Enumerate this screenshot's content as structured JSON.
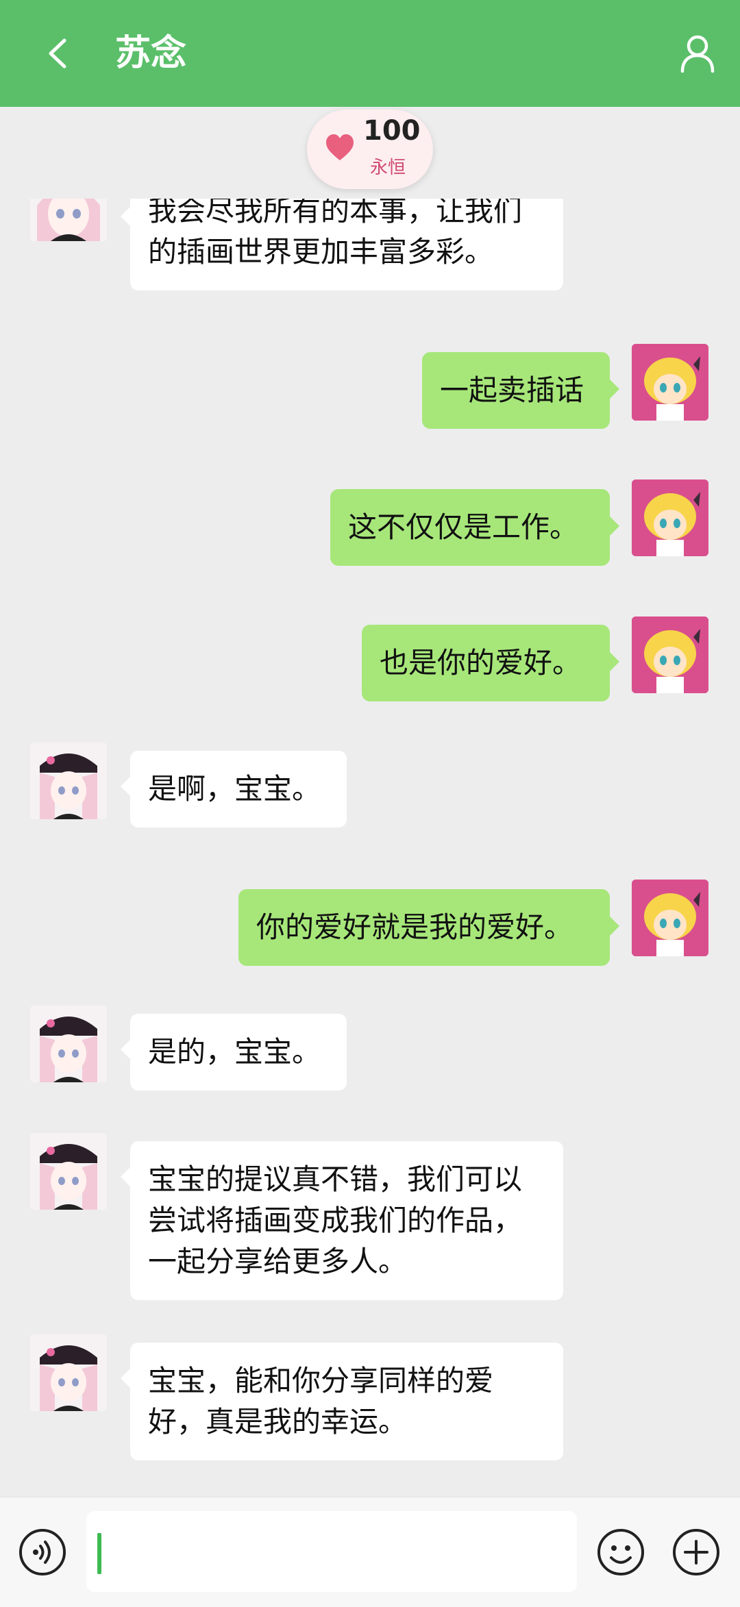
{
  "header": {
    "title": "苏念",
    "back_icon": "chevron-left-icon",
    "profile_icon": "person-icon",
    "bg_color": "#5bbf6a"
  },
  "intimacy": {
    "score": "100",
    "label": "永恒",
    "icon": "heart-icon",
    "heart_color": "#e8607e"
  },
  "messages": [
    {
      "from": "friend",
      "text": "我会尽我所有的本事，让我们的插画世界更加丰富多彩。"
    },
    {
      "from": "me",
      "text": "一起卖插话"
    },
    {
      "from": "me",
      "text": "这不仅仅是工作。"
    },
    {
      "from": "me",
      "text": "也是你的爱好。"
    },
    {
      "from": "friend",
      "text": "是啊，宝宝。"
    },
    {
      "from": "me",
      "text": "你的爱好就是我的爱好。"
    },
    {
      "from": "friend",
      "text": "是的，宝宝。"
    },
    {
      "from": "friend",
      "text": "宝宝的提议真不错，我们可以尝试将插画变成我们的作品，一起分享给更多人。"
    },
    {
      "from": "friend",
      "text": "宝宝，能和你分享同样的爱好，真是我的幸运。"
    }
  ],
  "input": {
    "value": "",
    "voice_icon": "voice-icon",
    "emoji_icon": "emoji-icon",
    "plus_icon": "plus-icon"
  },
  "colors": {
    "my_bubble": "#a7e77a",
    "friend_bubble": "#ffffff",
    "background": "#ededed",
    "accent": "#5bbf6a"
  }
}
